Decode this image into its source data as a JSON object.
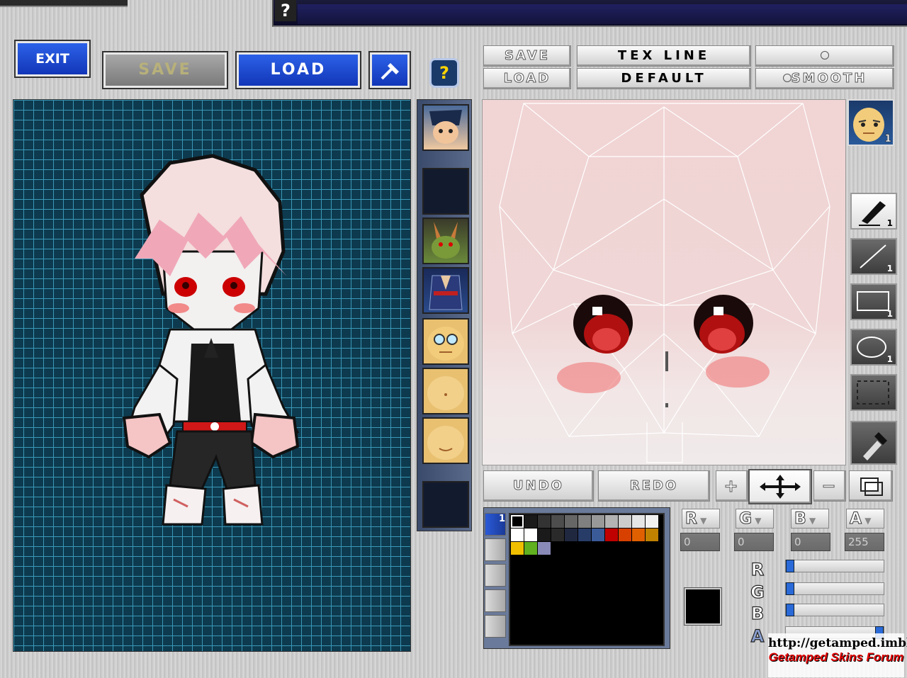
{
  "topbar": {
    "help_label": "?"
  },
  "toolbar": {
    "exit_label": "EXIT",
    "save_label": "SAVE",
    "load_label": "LOAD",
    "hammer_icon": "hammer-icon",
    "help_label": "?"
  },
  "texture_toolbar": {
    "save_label": "SAVE",
    "load_label": "LOAD",
    "tex_line_label": "TEX LINE",
    "default_label": "DEFAULT",
    "radio_1_label": "",
    "smooth_label": "SMOOTH"
  },
  "tools": [
    {
      "name": "pen-tool",
      "num": "1"
    },
    {
      "name": "line-tool",
      "num": "1"
    },
    {
      "name": "rect-tool",
      "num": "1"
    },
    {
      "name": "ellipse-tool",
      "num": "1"
    },
    {
      "name": "select-tool",
      "num": ""
    },
    {
      "name": "eyedropper-tool",
      "num": ""
    }
  ],
  "face_badge_num": "1",
  "edit_row": {
    "undo_label": "UNDO",
    "redo_label": "REDO",
    "zoom_in_label": "+",
    "zoom_out_label": "−"
  },
  "palette": {
    "selected_tab": "1",
    "colors": [
      "#000000",
      "#1a1a1a",
      "#333333",
      "#4d4d4d",
      "#666666",
      "#808080",
      "#999999",
      "#b3b3b3",
      "#cccccc",
      "#e6e6e6",
      "#f2f2f2",
      "#ffffff",
      "#ffffff",
      "#1a1a1a",
      "#2a2a2a",
      "#202840",
      "#283c68",
      "#3a5a98",
      "#c00000",
      "#d84000",
      "#e06000",
      "#c08000",
      "#f0c000",
      "#60b020",
      "#8a8ab8",
      "#000000",
      "#000000",
      "#000000",
      "#000000",
      "#000000",
      "#000000",
      "#000000",
      "#000000"
    ]
  },
  "rgba": {
    "r_label": "R",
    "g_label": "G",
    "b_label": "B",
    "a_label": "A",
    "r_value": "0",
    "g_value": "0",
    "b_value": "0",
    "a_value": "255"
  },
  "sliders": {
    "r_label": "R",
    "g_label": "G",
    "b_label": "B",
    "a_label": "A",
    "r_level": 0,
    "g_level": 0,
    "b_level": 0,
    "a_level": 1
  },
  "watermark": {
    "url": "http://getamped.imbbs.in",
    "forum": "Getamped Skins Forum"
  }
}
